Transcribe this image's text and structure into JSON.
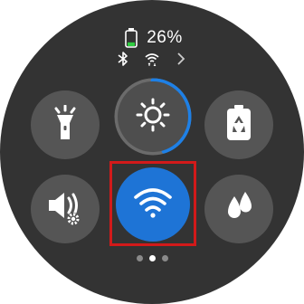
{
  "status": {
    "battery_percent": "26%",
    "battery_level": 0.26,
    "battery_color": "#2ecc40",
    "icons": [
      "battery-icon",
      "bluetooth-icon",
      "wifi-status-icon",
      "chevron-right-icon"
    ]
  },
  "quick_settings": {
    "tiles": [
      {
        "name": "flashlight",
        "icon": "flashlight-icon",
        "active": false
      },
      {
        "name": "brightness",
        "icon": "sun-icon",
        "active": false,
        "level": 0.45
      },
      {
        "name": "power-saving",
        "icon": "battery-recycle-icon",
        "active": false
      },
      {
        "name": "sound",
        "icon": "speaker-gear-icon",
        "active": false
      },
      {
        "name": "wifi",
        "icon": "wifi-icon",
        "active": true
      },
      {
        "name": "water-lock",
        "icon": "water-drop-icon",
        "active": false
      }
    ],
    "active_color": "#1e74d6",
    "tile_color": "#555555",
    "highlight_color": "#d21a1a",
    "highlighted_tile": "wifi"
  },
  "pager": {
    "pages": 3,
    "current": 2
  }
}
